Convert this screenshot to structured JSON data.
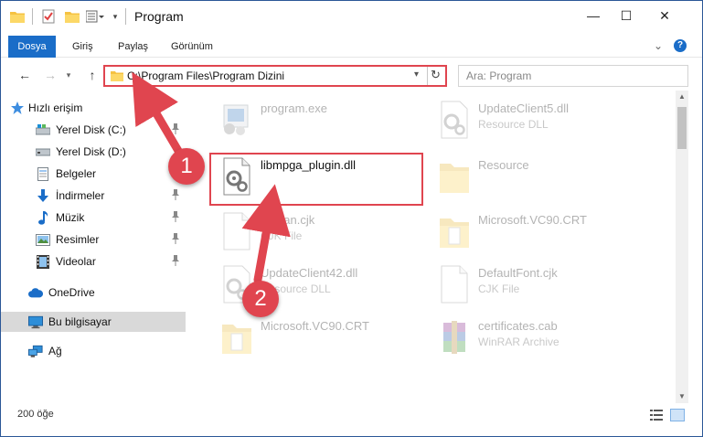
{
  "window": {
    "title": "Program",
    "controls": {
      "minimize": "—",
      "maximize": "☐",
      "close": "✕"
    }
  },
  "ribbon": {
    "tabs": [
      "Dosya",
      "Giriş",
      "Paylaş",
      "Görünüm"
    ],
    "collapse_icon": "chevron-down-icon",
    "help": "?"
  },
  "nav": {
    "back": "←",
    "forward": "→",
    "recent": "▾",
    "up": "↑",
    "address": "C:\\Program Files\\Program Dizini",
    "address_dropdown": "▾",
    "refresh": "↻",
    "search_placeholder": "Ara: Program"
  },
  "sidebar": {
    "items": [
      {
        "label": "Hızlı erişim",
        "icon": "star-icon"
      },
      {
        "label": "Yerel Disk (C:)",
        "icon": "drive-icon",
        "pinned": true
      },
      {
        "label": "Yerel Disk (D:)",
        "icon": "drive-icon",
        "pinned": false
      },
      {
        "label": "Belgeler",
        "icon": "document-icon",
        "pinned": true
      },
      {
        "label": "İndirmeler",
        "icon": "download-icon",
        "pinned": true
      },
      {
        "label": "Müzik",
        "icon": "music-icon",
        "pinned": true
      },
      {
        "label": "Resimler",
        "icon": "pictures-icon",
        "pinned": true
      },
      {
        "label": "Videolar",
        "icon": "video-icon",
        "pinned": true
      },
      {
        "label": "OneDrive",
        "icon": "cloud-icon"
      },
      {
        "label": "Bu bilgisayar",
        "icon": "computer-icon",
        "selected": true
      },
      {
        "label": "Ağ",
        "icon": "network-icon"
      }
    ]
  },
  "files": [
    {
      "name": "program.exe",
      "sub": "",
      "icon": "exe-icon",
      "faded": true
    },
    {
      "name": "UpdateClient5.dll",
      "sub": "Resource DLL",
      "icon": "dll-icon",
      "faded": true
    },
    {
      "name": "libmpga_plugin.dll",
      "sub": "",
      "icon": "dll-icon",
      "faded": false,
      "selected": true
    },
    {
      "name": "Resource",
      "sub": "",
      "icon": "folder-icon",
      "faded": true
    },
    {
      "name": "korean.cjk",
      "sub": "CJK File",
      "icon": "file-icon",
      "faded": true
    },
    {
      "name": "Microsoft.VC90.CRT",
      "sub": "",
      "icon": "folder-icon",
      "faded": true
    },
    {
      "name": "UpdateClient42.dll",
      "sub": "Resource DLL",
      "icon": "dll-icon",
      "faded": true
    },
    {
      "name": "DefaultFont.cjk",
      "sub": "CJK File",
      "icon": "file-icon",
      "faded": true
    },
    {
      "name": "Microsoft.VC90.CRT",
      "sub": "",
      "icon": "folder-icon",
      "faded": true
    },
    {
      "name": "certificates.cab",
      "sub": "WinRAR Archive",
      "icon": "winrar-icon",
      "faded": true
    }
  ],
  "status": {
    "count": "200 öğe"
  },
  "annotations": {
    "step1": "1",
    "step2": "2",
    "color": "#e0454f"
  },
  "colors": {
    "accent": "#1a6dc8",
    "highlight": "#e0454f",
    "selected_nav": "#d9d9d9"
  }
}
